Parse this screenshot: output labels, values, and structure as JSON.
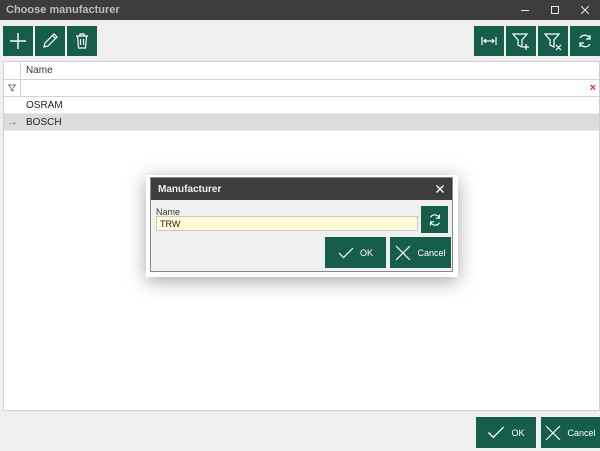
{
  "window": {
    "title": "Choose manufacturer",
    "minimize_glyph": "–",
    "maximize_glyph": "☐",
    "close_glyph": "✕"
  },
  "toolbar": {
    "left": [
      "plus-icon",
      "pencil-icon",
      "trash-icon"
    ],
    "right": [
      "fit-columns-icon",
      "filter-add-icon",
      "filter-clear-icon",
      "refresh-icon"
    ]
  },
  "grid": {
    "column_header": "Name",
    "filter_value": "",
    "filter_clear_glyph": "×",
    "rows": [
      {
        "name": "OSRAM",
        "selected": false
      },
      {
        "name": "BOSCH",
        "selected": true
      }
    ],
    "current_row_glyph": "→"
  },
  "dialog": {
    "title": "Manufacturer",
    "close_glyph": "✕",
    "name_label": "Name",
    "name_value": "TRW",
    "ok_label": "OK",
    "cancel_label": "Cancel"
  },
  "footer": {
    "ok_label": "OK",
    "cancel_label": "Cancel"
  },
  "colors": {
    "accent": "#175d4c",
    "titlebar": "#3d3d3d",
    "input_highlight": "#fffbd6"
  }
}
